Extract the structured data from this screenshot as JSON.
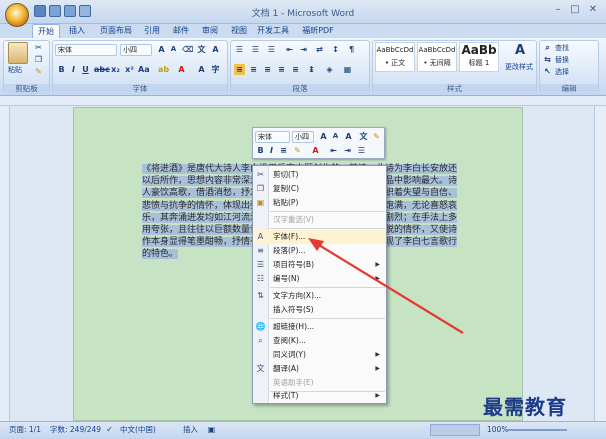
{
  "window": {
    "title": "文档 1 - Microsoft Word",
    "minimize": "–",
    "maximize": "□",
    "close": "✕"
  },
  "tabs": [
    "开始",
    "插入",
    "页面布局",
    "引用",
    "邮件",
    "审阅",
    "视图",
    "开发工具",
    "福昕PDF"
  ],
  "ribbon": {
    "clipboard": {
      "paste": "粘贴",
      "label": "剪贴板"
    },
    "font": {
      "name": "宋体",
      "size": "小四",
      "label": "字体"
    },
    "paragraph": {
      "label": "段落"
    },
    "styles": {
      "label": "样式",
      "items": [
        {
          "preview": "AaBbCcDd",
          "name": "• 正文"
        },
        {
          "preview": "AaBbCcDd",
          "name": "• 无间隔"
        },
        {
          "preview": "AaBb",
          "name": "标题 1"
        }
      ],
      "change": "更改样式"
    },
    "editing": {
      "find": "查找",
      "replace": "替换",
      "select": "选择",
      "label": "编辑"
    }
  },
  "document": {
    "text": "《将进酒》是唐代大诗人李白沿用乐府古题创作的一首诗。此诗为李白长安放还以后所作，思想内容非常深沉，艺术表现非常成熟，在同类作品中影响最大。诗人豪饮高歌，借酒消愁，抒发了忧愤深广的人生感慨。诗中交织着失望与自信、悲愤与抗争的情怀，体现出强烈的豪纵狂放的个性。全诗情感饱满，无论喜怒哀乐，其奔涌迸发均如江河流泻，不可遏止，且起伏跌宕，变化剧烈；在手法上多用夸张，且往往以巨额数量词进行修饰，既表现出诗人豪迈洒脱的情怀，又使诗作本身显得笔墨酣畅，抒情有力；在结构上大开大阖，充分体现了李白七言歌行的特色。"
  },
  "minitoolbar": {
    "font": "宋体",
    "size": "小四"
  },
  "context_menu": [
    {
      "label": "剪切(T)",
      "icon": "scissors-icon",
      "disabled": false,
      "submenu": false
    },
    {
      "label": "复制(C)",
      "icon": "copy-icon",
      "disabled": false,
      "submenu": false
    },
    {
      "label": "粘贴(P)",
      "icon": "paste-icon",
      "disabled": false,
      "submenu": false
    },
    {
      "label": "汉字重选(V)",
      "icon": "",
      "disabled": true,
      "submenu": false
    },
    {
      "label": "字体(F)...",
      "icon": "font-icon",
      "disabled": false,
      "submenu": false
    },
    {
      "label": "段落(P)...",
      "icon": "paragraph-icon",
      "disabled": false,
      "submenu": false
    },
    {
      "label": "项目符号(B)",
      "icon": "bullets-icon",
      "disabled": false,
      "submenu": true
    },
    {
      "label": "编号(N)",
      "icon": "numbering-icon",
      "disabled": false,
      "submenu": true
    },
    {
      "label": "文字方向(X)...",
      "icon": "text-direction-icon",
      "disabled": false,
      "submenu": false
    },
    {
      "label": "插入符号(S)",
      "icon": "",
      "disabled": false,
      "submenu": false
    },
    {
      "label": "超链接(H)...",
      "icon": "hyperlink-icon",
      "disabled": false,
      "submenu": false
    },
    {
      "label": "查阅(K)...",
      "icon": "lookup-icon",
      "disabled": false,
      "submenu": false
    },
    {
      "label": "同义词(Y)",
      "icon": "",
      "disabled": false,
      "submenu": true
    },
    {
      "label": "翻译(A)",
      "icon": "translate-icon",
      "disabled": false,
      "submenu": true
    },
    {
      "label": "英语助手(E)",
      "icon": "",
      "disabled": true,
      "submenu": false
    },
    {
      "label": "样式(T)",
      "icon": "",
      "disabled": false,
      "submenu": true
    }
  ],
  "status": {
    "page": "页面: 1/1",
    "words": "字数: 249/249",
    "language": "中文(中国)",
    "mode": "插入",
    "zoom": "100%"
  },
  "watermark": "最需教育",
  "colors": {
    "accent": "#15428b",
    "page": "#c6e3c3",
    "selection": "#a8c0da",
    "arrow": "#e53935"
  }
}
